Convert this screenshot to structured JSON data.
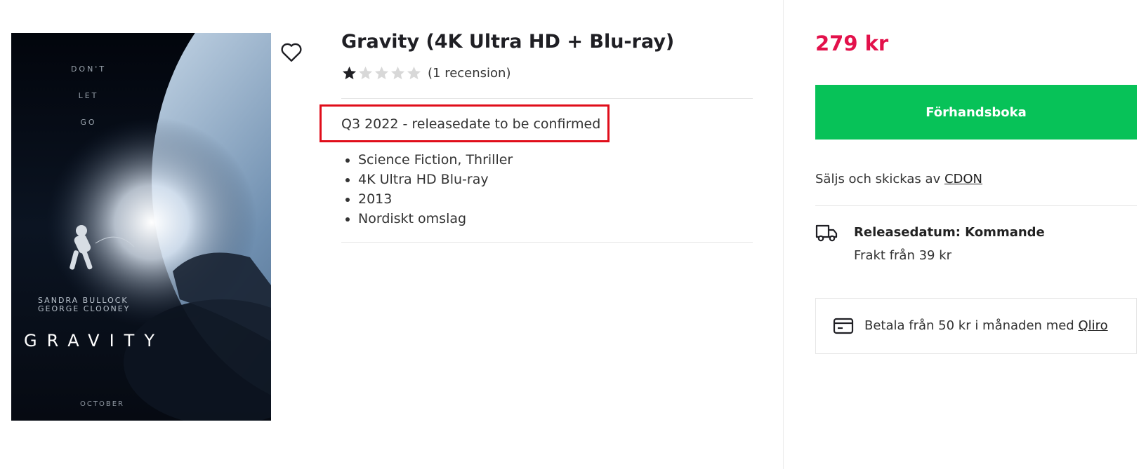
{
  "product": {
    "title": "Gravity (4K Ultra HD + Blu-ray)",
    "rating_value": 1,
    "rating_max": 5,
    "review_count_text": "(1 recension)",
    "release_note": "Q3 2022 - releasedate to be confirmed",
    "features": [
      "Science Fiction, Thriller",
      "4K Ultra HD Blu-ray",
      "2013",
      "Nordiskt omslag"
    ],
    "poster": {
      "tagline_1": "DON'T",
      "tagline_2": "LET",
      "tagline_3": "GO",
      "actor_1": "SANDRA BULLOCK",
      "actor_2": "GEORGE CLOONEY",
      "title": "GRAVITY",
      "month": "OCTOBER"
    }
  },
  "sidebar": {
    "price": "279 kr",
    "cta_label": "Förhandsboka",
    "seller_prefix": "Säljs och skickas av ",
    "seller_name": "CDON",
    "release_label": "Releasedatum: Kommande",
    "freight_text": "Frakt från 39 kr",
    "payment_prefix": "Betala från 50 kr i månaden med ",
    "payment_provider": "Qliro"
  },
  "icons": {
    "favorite": "heart-icon",
    "delivery": "truck-icon",
    "payment": "credit-card-icon",
    "rating": "star-icon"
  },
  "colors": {
    "price": "#e3114b",
    "cta": "#07c258",
    "highlight_border": "#e00d1a",
    "star_filled": "#1f1f24",
    "star_empty": "#d8d8d8"
  }
}
